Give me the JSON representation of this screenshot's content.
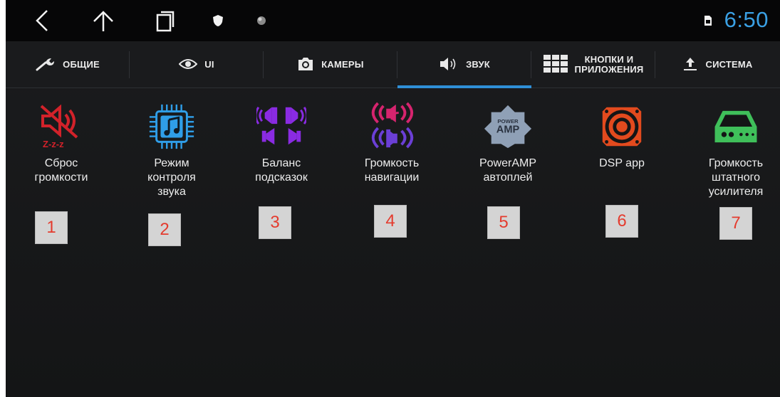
{
  "status_bar": {
    "time": "6:50",
    "icons": [
      "back-icon",
      "home-icon",
      "recents-icon",
      "shield-icon",
      "dot-icon",
      "sim-icon"
    ]
  },
  "tabs": [
    {
      "label": "ОБЩИЕ",
      "icon": "wrench-icon"
    },
    {
      "label": "UI",
      "icon": "eye-icon"
    },
    {
      "label": "КАМЕРЫ",
      "icon": "camera-icon"
    },
    {
      "label": "ЗВУК",
      "icon": "speaker-icon",
      "active": true
    },
    {
      "label": "КНОПКИ И\nПРИЛОЖЕНИЯ",
      "icon": "grid-icon"
    },
    {
      "label": "СИСТЕМА",
      "icon": "upload-icon"
    }
  ],
  "items": [
    {
      "label": "Сброс\nгромкости",
      "icon": "mute-speaker-icon",
      "badge": "1"
    },
    {
      "label": "Режим\nконтроля\nзвука",
      "icon": "music-chip-icon",
      "badge": "2"
    },
    {
      "label": "Баланс\nподсказок",
      "icon": "balance-speakers-icon",
      "badge": "3"
    },
    {
      "label": "Громкость\nнавигации",
      "icon": "nav-volume-icon",
      "badge": "4"
    },
    {
      "label": "PowerAMP\nавтоплей",
      "icon": "power-amp-icon",
      "badge": "5",
      "icon_text_top": "POWER",
      "icon_text_bottom": "AMP"
    },
    {
      "label": "DSP app",
      "icon": "dsp-speaker-icon",
      "badge": "6"
    },
    {
      "label": "Громкость\nштатного\nусилителя",
      "icon": "amplifier-icon",
      "badge": "7"
    }
  ],
  "colors": {
    "accent": "#2f8fd6",
    "clock": "#3aa0e4",
    "badge_text": "#e43b2e"
  }
}
